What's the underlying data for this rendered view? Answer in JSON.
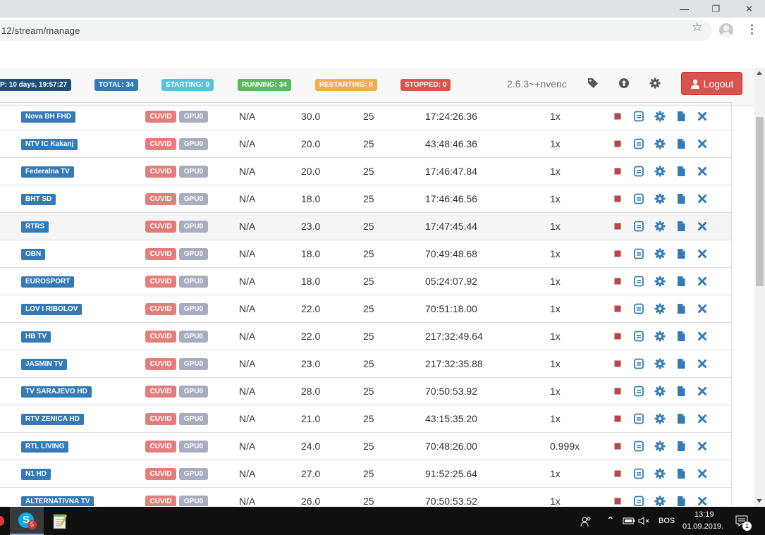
{
  "browser": {
    "url": "12/stream/manage",
    "minimize_glyph": "—",
    "maximize_glyph": "❐",
    "close_glyph": "✕"
  },
  "header": {
    "uptime": "P: 10 days, 19:57:27",
    "total": "TOTAL: 34",
    "starting": "STARTING: 0",
    "running": "RUNNING: 34",
    "restarting": "RESTARTING: 0",
    "stopped": "STOPPED: 0",
    "version": "2.6.3~+nvenc",
    "logout": "Logout",
    "icons": [
      "tag-icon",
      "upload-icon",
      "settings-icon",
      "user-icon"
    ]
  },
  "table": {
    "decoder_label": "CUVID",
    "gpu_label": "GPU0",
    "rows": [
      {
        "name": "Nova BH FHD",
        "na": "N/A",
        "fps": "30.0",
        "br": "25",
        "time": "17:24:26.36",
        "speed": "1x"
      },
      {
        "name": "NTV IC Kakanj",
        "na": "N/A",
        "fps": "20.0",
        "br": "25",
        "time": "43:48:46.36",
        "speed": "1x"
      },
      {
        "name": "Federalna TV",
        "na": "N/A",
        "fps": "20.0",
        "br": "25",
        "time": "17:46:47.84",
        "speed": "1x"
      },
      {
        "name": "BHT SD",
        "na": "N/A",
        "fps": "18.0",
        "br": "25",
        "time": "17:46:46.56",
        "speed": "1x"
      },
      {
        "name": "RTRS",
        "na": "N/A",
        "fps": "23.0",
        "br": "25",
        "time": "17:47:45.44",
        "speed": "1x"
      },
      {
        "name": "OBN",
        "na": "N/A",
        "fps": "18.0",
        "br": "25",
        "time": "70:49:48.68",
        "speed": "1x"
      },
      {
        "name": "EUROSPORT",
        "na": "N/A",
        "fps": "18.0",
        "br": "25",
        "time": "05:24:07.92",
        "speed": "1x"
      },
      {
        "name": "LOV I RIBOLOV",
        "na": "N/A",
        "fps": "22.0",
        "br": "25",
        "time": "70:51:18.00",
        "speed": "1x"
      },
      {
        "name": "HB TV",
        "na": "N/A",
        "fps": "22.0",
        "br": "25",
        "time": "217:32:49.64",
        "speed": "1x"
      },
      {
        "name": "JASMIN TV",
        "na": "N/A",
        "fps": "23.0",
        "br": "25",
        "time": "217:32:35.88",
        "speed": "1x"
      },
      {
        "name": "TV SARAJEVO HD",
        "na": "N/A",
        "fps": "28.0",
        "br": "25",
        "time": "70:50:53.92",
        "speed": "1x"
      },
      {
        "name": "RTV ZENICA HD",
        "na": "N/A",
        "fps": "21.0",
        "br": "25",
        "time": "43:15:35.20",
        "speed": "1x"
      },
      {
        "name": "RTL LIVING",
        "na": "N/A",
        "fps": "24.0",
        "br": "25",
        "time": "70:48:26.00",
        "speed": "0.999x"
      },
      {
        "name": "N1 HD",
        "na": "N/A",
        "fps": "27.0",
        "br": "25",
        "time": "91:52:25.64",
        "speed": "1x"
      },
      {
        "name": "ALTERNATIVNA TV",
        "na": "N/A",
        "fps": "26.0",
        "br": "25",
        "time": "70:50:53.52",
        "speed": "1x"
      }
    ],
    "row_actions": [
      "stop-icon",
      "log-icon",
      "settings-icon",
      "document-icon",
      "delete-icon"
    ]
  },
  "taskbar": {
    "language": "BOS",
    "time": "13:19",
    "date": "01.09.2019.",
    "skype_badge": "5",
    "notification_count": "1"
  },
  "colors": {
    "primary": "#337ab7",
    "info": "#5bc0de",
    "success": "#5cb85c",
    "warning": "#f0ad4e",
    "danger": "#d9534f"
  }
}
